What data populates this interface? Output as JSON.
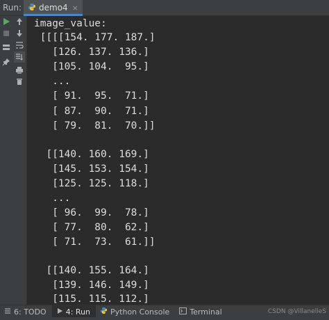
{
  "header": {
    "run_label": "Run:",
    "tab_label": "demo4",
    "close_glyph": "×"
  },
  "toolbar": {
    "icons": [
      "run-icon",
      "stop-icon",
      "layout-icon",
      "pin-icon",
      "up-arrow-icon",
      "down-arrow-icon",
      "soft-wrap-icon",
      "scroll-to-end-icon",
      "print-icon",
      "trash-icon"
    ],
    "colors": {
      "run": "#59a869",
      "stop": "#6e6e6e",
      "icon": "#afb1b3"
    }
  },
  "console": {
    "lines": [
      "image_value:",
      " [[[[154. 177. 187.]",
      "   [126. 137. 136.]",
      "   [105. 104.  95.]",
      "   ...",
      "   [ 91.  95.  71.]",
      "   [ 87.  90.  71.]",
      "   [ 79.  81.  70.]]",
      "",
      "  [[140. 160. 169.]",
      "   [145. 153. 154.]",
      "   [125. 125. 118.]",
      "   ...",
      "   [ 96.  99.  78.]",
      "   [ 77.  80.  62.]",
      "   [ 71.  73.  61.]]",
      "",
      "  [[140. 155. 164.]",
      "   [139. 146. 149.]",
      "   [115. 115. 112.]"
    ]
  },
  "bottom_bar": {
    "todo": "6: TODO",
    "run": "4: Run",
    "python_console": "Python Console",
    "terminal": "Terminal",
    "watermark": "CSDN @VillanelleS"
  }
}
